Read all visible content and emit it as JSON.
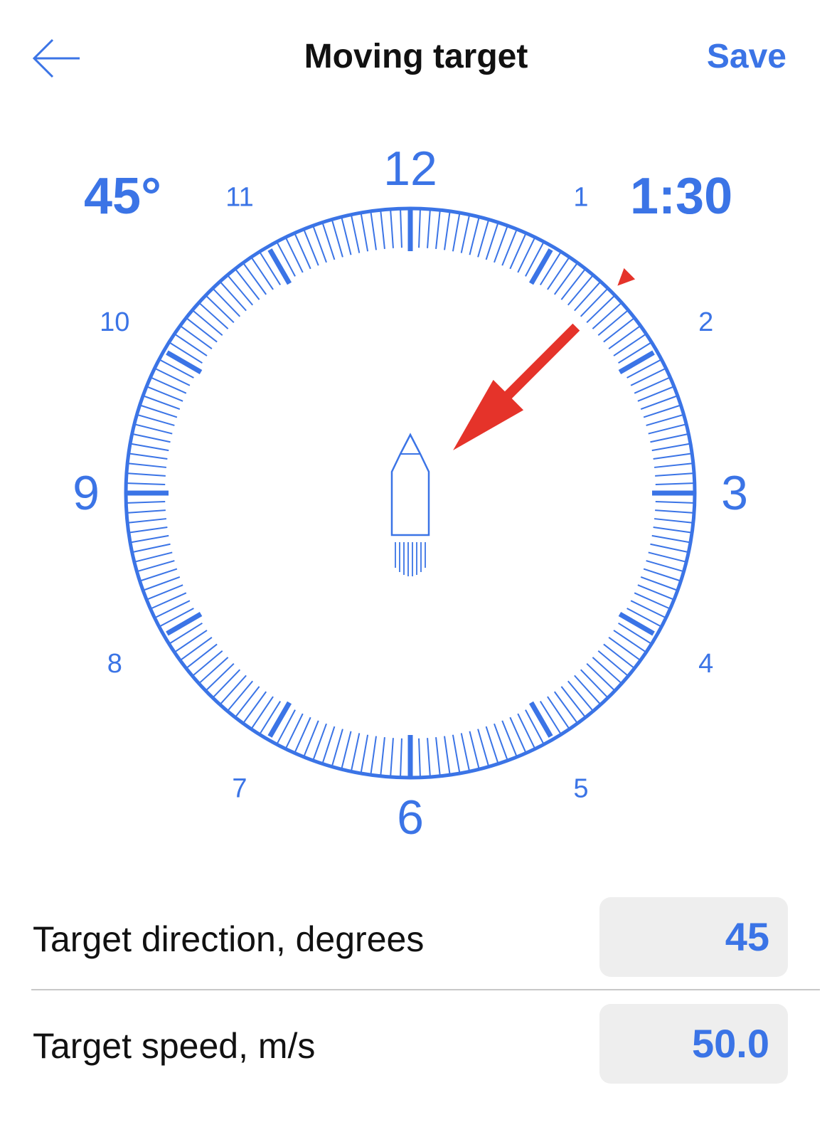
{
  "header": {
    "title": "Moving target",
    "save_label": "Save",
    "back_icon": "arrow-left-icon"
  },
  "dial": {
    "angle_readout": "45°",
    "clock_readout": "1:30",
    "major_labels": [
      "12",
      "3",
      "6",
      "9"
    ],
    "minor_labels": [
      "1",
      "2",
      "4",
      "5",
      "7",
      "8",
      "10",
      "11"
    ],
    "direction_degrees": 45,
    "accent_color": "#3b74e6",
    "arrow_color": "#e5332a",
    "center_icon": "boat-icon",
    "pointer_icon": "triangle-marker-icon"
  },
  "fields": {
    "direction": {
      "label": "Target direction, degrees",
      "value": "45"
    },
    "speed": {
      "label": "Target speed, m/s",
      "value": "50.0"
    }
  }
}
